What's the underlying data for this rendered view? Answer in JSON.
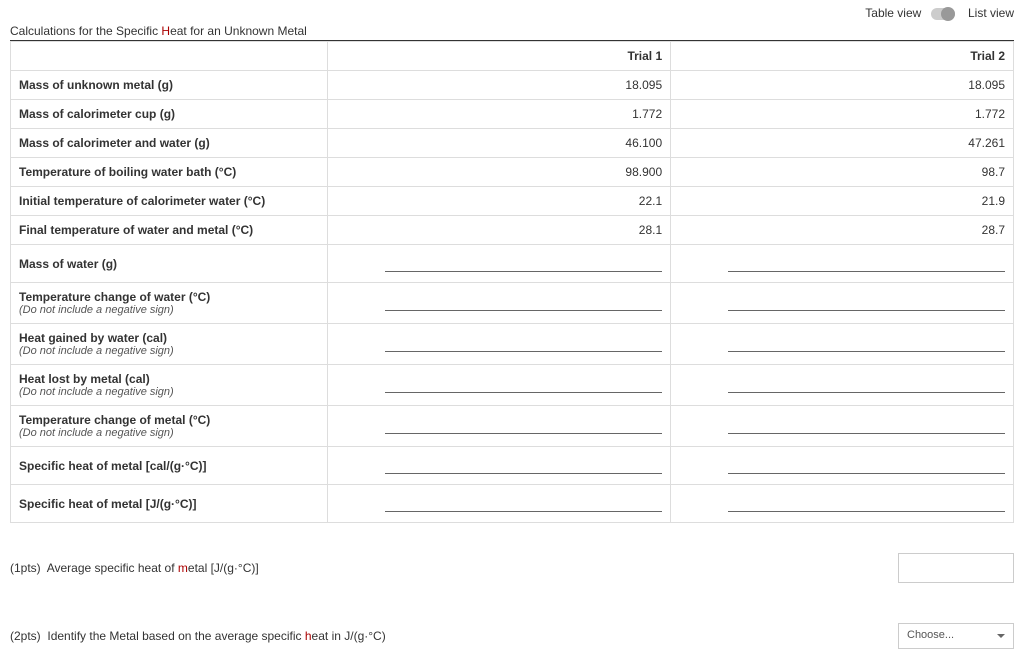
{
  "viewToggle": {
    "left": "Table view",
    "right": "List view"
  },
  "title": {
    "prefix": "Calculations for the Specific ",
    "hl": "H",
    "rest": "eat for an Unknown Metal"
  },
  "headers": {
    "blank": "",
    "trial1": "Trial 1",
    "trial2": "Trial 2"
  },
  "rows": [
    {
      "label": "Mass of unknown metal (g)",
      "t1": "18.095",
      "t2": "18.095"
    },
    {
      "label": "Mass of calorimeter cup (g)",
      "t1": "1.772",
      "t2": "1.772"
    },
    {
      "label": "Mass of calorimeter and water (g)",
      "t1": "46.100",
      "t2": "47.261"
    },
    {
      "label": "Temperature of boiling water bath (°C)",
      "t1": "98.900",
      "t2": "98.7"
    },
    {
      "label": "Initial temperature of calorimeter water (°C)",
      "t1": "22.1",
      "t2": "21.9"
    },
    {
      "label": "Final temperature of water and metal (°C)",
      "t1": "28.1",
      "t2": "28.7"
    }
  ],
  "inputRows": [
    {
      "label": "Mass of water (g)",
      "note": ""
    },
    {
      "label": "Temperature change of water (°C)",
      "note": "(Do not include a negative sign)"
    },
    {
      "label": "Heat gained by water (cal)",
      "note": "(Do not include a negative sign)"
    },
    {
      "label": "Heat lost by metal (cal)",
      "note": "(Do not include a negative sign)"
    },
    {
      "label": "Temperature change of metal (°C)",
      "note": "(Do not include a negative sign)"
    },
    {
      "label": "Specific heat of metal [cal/(g·°C)]",
      "note": ""
    },
    {
      "label": "Specific heat of metal [J/(g·°C)]",
      "note": ""
    }
  ],
  "q1": {
    "pts": "(1pts)",
    "text_prefix": "Average specific heat of ",
    "hl": "m",
    "text_rest": "etal [J/(g·°C)]"
  },
  "q2": {
    "pts": "(2pts)",
    "text_prefix": "Identify the Metal based on the average specific ",
    "hl": "h",
    "text_rest": "eat in J/(g·°C)",
    "placeholder": "Choose..."
  }
}
